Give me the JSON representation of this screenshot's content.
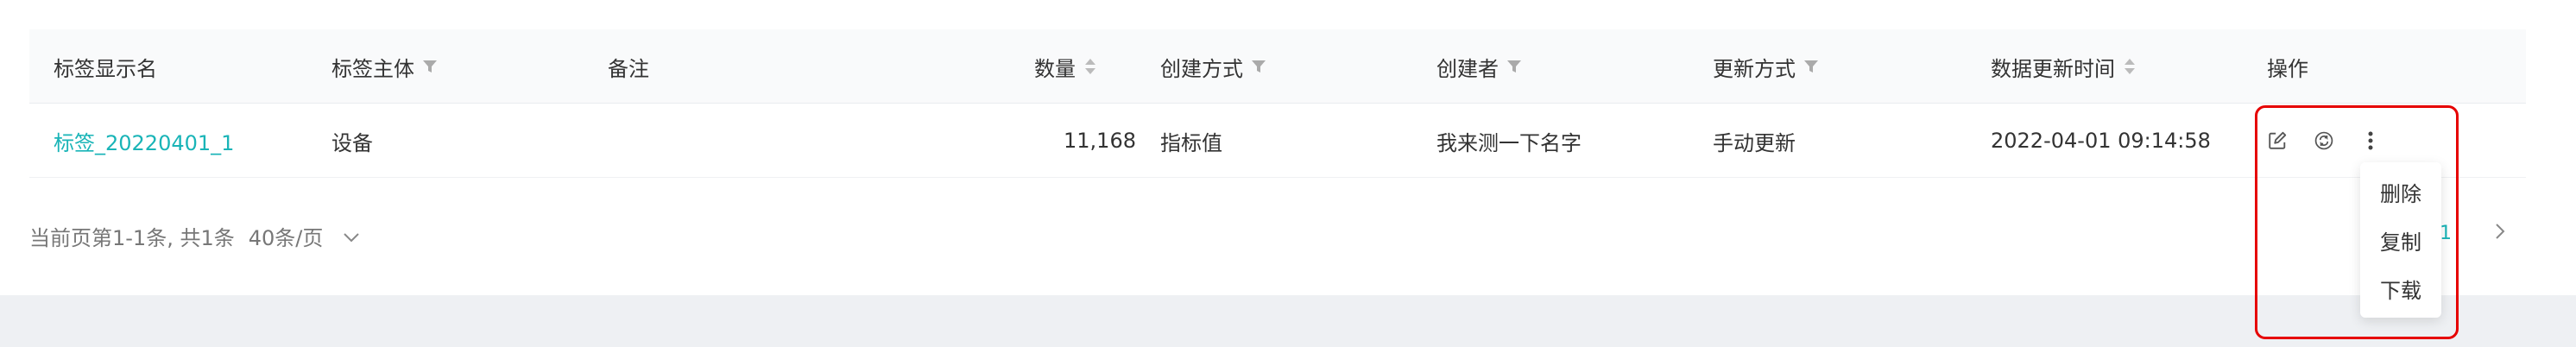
{
  "table": {
    "columns": [
      {
        "label": "标签显示名"
      },
      {
        "label": "标签主体",
        "icon": "filter-icon"
      },
      {
        "label": "备注"
      },
      {
        "label": "数量",
        "icon": "sort-icon"
      },
      {
        "label": "创建方式",
        "icon": "filter-icon"
      },
      {
        "label": "创建者",
        "icon": "filter-icon"
      },
      {
        "label": "更新方式",
        "icon": "filter-icon"
      },
      {
        "label": "数据更新时间",
        "icon": "sort-icon"
      },
      {
        "label": "操作"
      }
    ],
    "rows": [
      {
        "name": "标签_20220401_1",
        "subject": "设备",
        "note": "",
        "count": "11,168",
        "create_method": "指标值",
        "creator": "我来测一下名字",
        "update_method": "手动更新",
        "updated_at": "2022-04-01 09:14:58",
        "actions": [
          "edit-icon",
          "refresh-icon",
          "more-icon"
        ]
      }
    ]
  },
  "pagination": {
    "summary": "当前页第1-1条, 共1条",
    "page_size": "40条/页",
    "current_page": "1"
  },
  "menu": {
    "items": [
      "删除",
      "复制",
      "下载"
    ]
  },
  "colors": {
    "link": "#19b4b7",
    "highlight": "#e60000",
    "header_bg": "#f9fafb",
    "page_bg": "#eef0f3"
  }
}
